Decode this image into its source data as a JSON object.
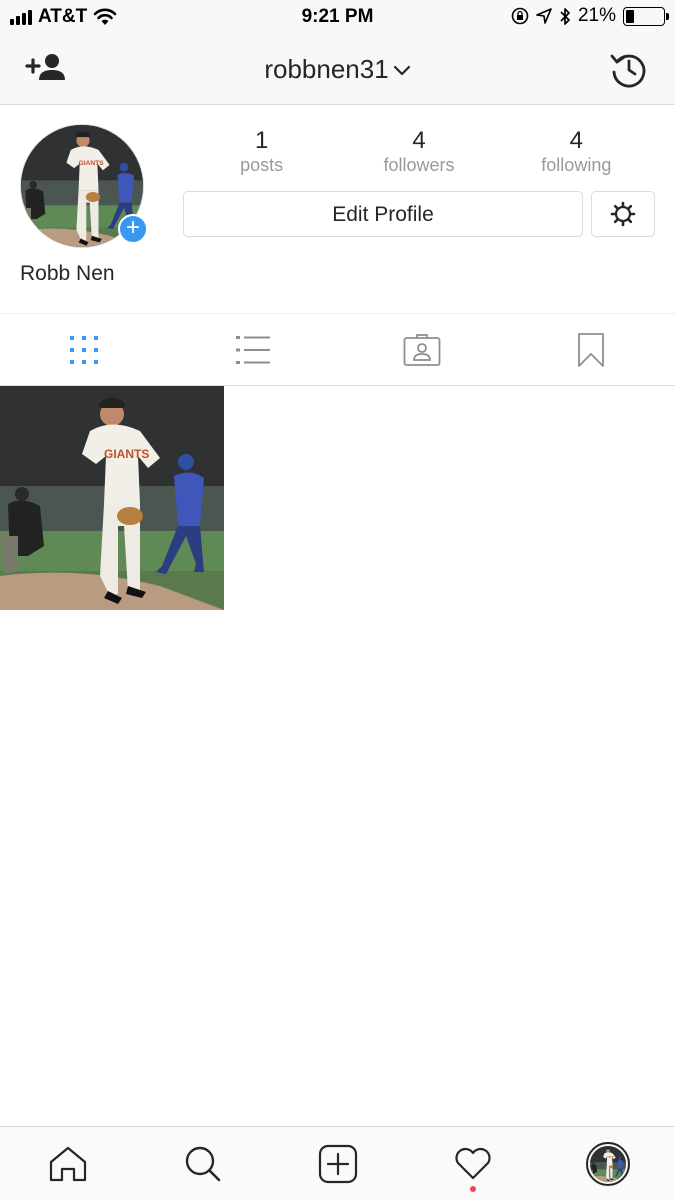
{
  "status_bar": {
    "carrier": "AT&T",
    "time": "9:21 PM",
    "battery_percent": "21%",
    "battery_level": 0.21,
    "icons": [
      "signal-icon",
      "wifi-icon",
      "orientation-lock-icon",
      "location-icon",
      "bluetooth-icon",
      "battery-icon"
    ]
  },
  "header": {
    "username": "robbnen31",
    "left_icon": "add-person-icon",
    "right_icon": "archive-history-icon"
  },
  "profile": {
    "display_name": "Robb Nen",
    "stats": [
      {
        "value": "1",
        "label": "posts"
      },
      {
        "value": "4",
        "label": "followers"
      },
      {
        "value": "4",
        "label": "following"
      }
    ],
    "edit_label": "Edit Profile",
    "settings_icon": "gear-icon",
    "add_story_icon": "plus-icon"
  },
  "tabs": [
    {
      "icon": "grid-icon",
      "active": true
    },
    {
      "icon": "list-icon",
      "active": false
    },
    {
      "icon": "tagged-icon",
      "active": false
    },
    {
      "icon": "bookmark-icon",
      "active": false
    }
  ],
  "posts_count": 1,
  "bottom_nav": [
    {
      "icon": "home-icon"
    },
    {
      "icon": "search-icon"
    },
    {
      "icon": "new-post-icon"
    },
    {
      "icon": "activity-heart-icon",
      "has_notification": true
    },
    {
      "icon": "profile-avatar-icon"
    }
  ],
  "colors": {
    "accent": "#3897f0",
    "text": "#262626",
    "muted": "#999999",
    "border": "#dbdbdb",
    "notification": "#ed4956"
  }
}
